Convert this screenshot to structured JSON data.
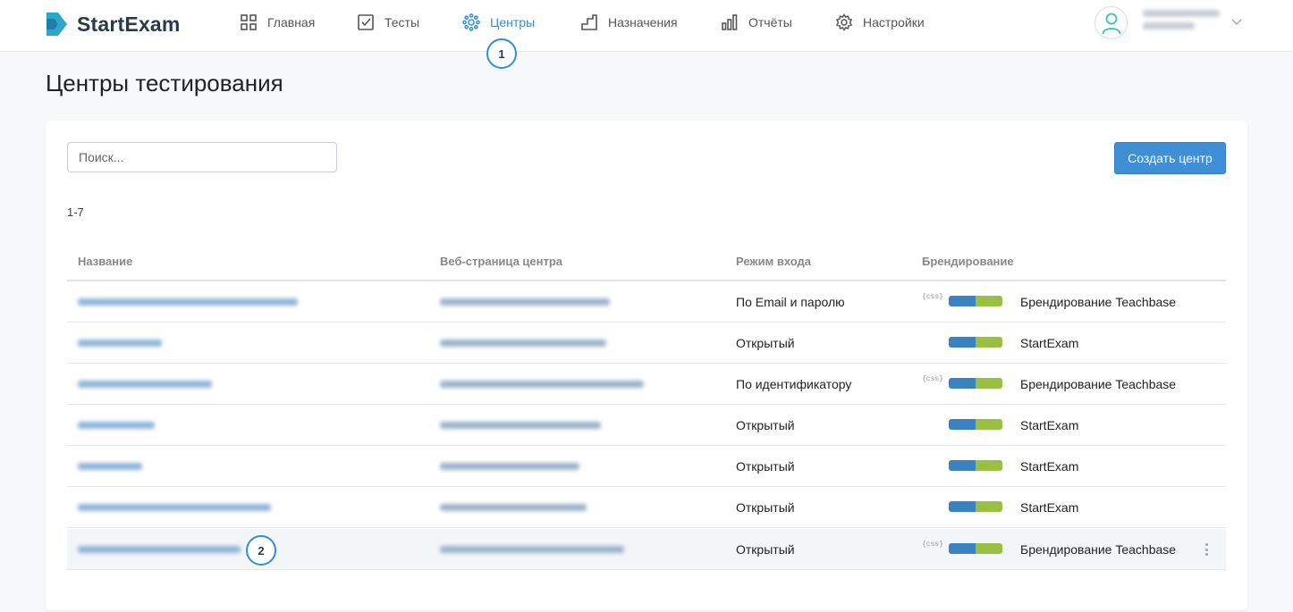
{
  "app": {
    "name": "StartExam",
    "brand_color": "#2f8fd8"
  },
  "nav": [
    {
      "label": "Главная",
      "icon": "grid-icon",
      "active": false
    },
    {
      "label": "Тесты",
      "icon": "checkbox-icon",
      "active": false
    },
    {
      "label": "Центры",
      "icon": "dots-circle-icon",
      "active": true
    },
    {
      "label": "Назначения",
      "icon": "stairs-icon",
      "active": false
    },
    {
      "label": "Отчёты",
      "icon": "bar-chart-icon",
      "active": false
    },
    {
      "label": "Настройки",
      "icon": "gear-icon",
      "active": false
    }
  ],
  "user": {
    "avatar_icon": "user-icon",
    "menu_icon": "chevron-down-icon"
  },
  "step_markers": [
    "1",
    "2"
  ],
  "page": {
    "title": "Центры тестирования"
  },
  "toolbar": {
    "search_placeholder": "Поиск...",
    "search_value": "",
    "create_label": "Создать центр"
  },
  "range": "1-7",
  "table": {
    "columns": [
      "Название",
      "Веб-страница центра",
      "Режим входа",
      "Брендирование"
    ],
    "rows": [
      {
        "mode": "По Email и паролю",
        "branding": "Брендирование Teachbase",
        "css": true
      },
      {
        "mode": "Открытый",
        "branding": "StartExam",
        "css": false
      },
      {
        "mode": "По идентификатору",
        "branding": "Брендирование Teachbase",
        "css": true
      },
      {
        "mode": "Открытый",
        "branding": "StartExam",
        "css": false
      },
      {
        "mode": "Открытый",
        "branding": "StartExam",
        "css": false
      },
      {
        "mode": "Открытый",
        "branding": "StartExam",
        "css": false
      },
      {
        "mode": "Открытый",
        "branding": "Брендирование Teachbase",
        "css": true
      }
    ],
    "css_tag": "{css}",
    "row_menu_icon": "kebab-menu-icon",
    "brand_colors": [
      "#3a83c0",
      "#9ac043"
    ]
  }
}
